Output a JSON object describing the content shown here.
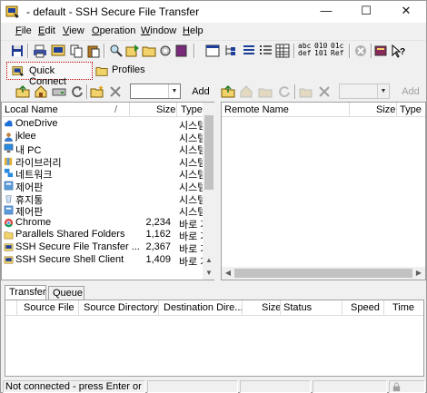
{
  "window": {
    "title": "- default - SSH Secure File Transfer",
    "minimize": "—",
    "maximize": "☐",
    "close": "✕"
  },
  "menu": [
    {
      "label": "File",
      "ul": "F",
      "rest": "ile"
    },
    {
      "label": "Edit",
      "ul": "E",
      "rest": "dit"
    },
    {
      "label": "View",
      "ul": "V",
      "rest": "iew"
    },
    {
      "label": "Operation",
      "ul": "O",
      "rest": "peration"
    },
    {
      "label": "Window",
      "ul": "W",
      "rest": "indow"
    },
    {
      "label": "Help",
      "ul": "H",
      "rest": "elp"
    }
  ],
  "toolbar": {
    "ascii_label_top": "abc",
    "ascii_label_bot": "def",
    "binary_label_top": "010",
    "binary_label_bot": "101",
    "auto_label_top": "01c",
    "auto_label_bot": "Ref"
  },
  "quick_connect": {
    "label": "Quick Connect"
  },
  "profiles": {
    "label": "Profiles"
  },
  "left_toolbar": {
    "add_label": "Add"
  },
  "right_toolbar": {
    "add_label": "Add"
  },
  "local_pane": {
    "columns": {
      "name": "Local Name",
      "sort": "/",
      "size": "Size",
      "type": "Type"
    },
    "rows": [
      {
        "icon": "onedrive-icon",
        "name": "OneDrive",
        "size": "",
        "type": "시스템"
      },
      {
        "icon": "user-icon",
        "name": "jklee",
        "size": "",
        "type": "시스템"
      },
      {
        "icon": "pc-icon",
        "name": "내 PC",
        "size": "",
        "type": "시스템"
      },
      {
        "icon": "library-icon",
        "name": "라이브러리",
        "size": "",
        "type": "시스템"
      },
      {
        "icon": "network-icon",
        "name": "네트워크",
        "size": "",
        "type": "시스템"
      },
      {
        "icon": "control-panel-icon",
        "name": "제어판",
        "size": "",
        "type": "시스템"
      },
      {
        "icon": "recycle-bin-icon",
        "name": "휴지통",
        "size": "",
        "type": "시스템"
      },
      {
        "icon": "control-panel-icon",
        "name": "제어판",
        "size": "",
        "type": "시스템"
      },
      {
        "icon": "chrome-icon",
        "name": "Chrome",
        "size": "2,234",
        "type": "바로 가"
      },
      {
        "icon": "shortcut-icon",
        "name": "Parallels Shared Folders",
        "size": "1,162",
        "type": "바로 가"
      },
      {
        "icon": "ssh-icon",
        "name": "SSH Secure File Transfer ...",
        "size": "2,367",
        "type": "바로 가"
      },
      {
        "icon": "ssh-icon",
        "name": "SSH Secure Shell Client",
        "size": "1,409",
        "type": "바로 가"
      }
    ]
  },
  "remote_pane": {
    "columns": {
      "name": "Remote Name",
      "size": "Size",
      "type": "Type"
    }
  },
  "transfer": {
    "tabs": [
      "Transfer",
      "Queue"
    ],
    "columns": [
      "Source File",
      "Source Directory",
      "Destination Dire...",
      "Size",
      "Status",
      "Speed",
      "Time"
    ]
  },
  "status": {
    "text": "Not connected - press Enter or Space"
  }
}
